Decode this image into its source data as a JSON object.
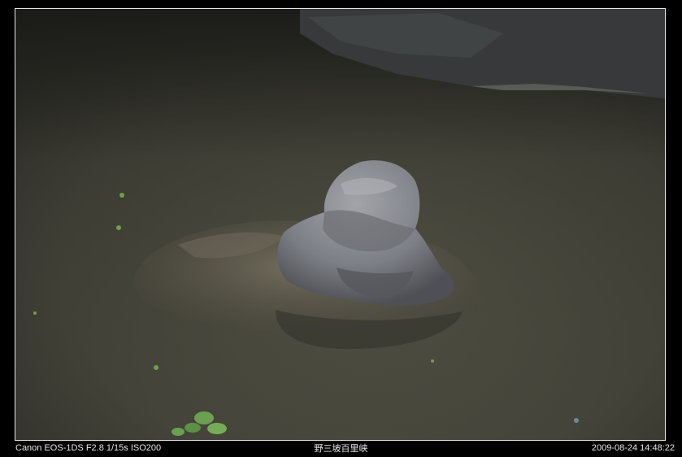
{
  "captions": {
    "camera_info": "Canon EOS-1DS F2.8 1/15s ISO200",
    "location_title": "野三坡百里峡",
    "timestamp": "2009-08-24 14:48:22"
  },
  "scene": {
    "subject": "rock-in-water",
    "colors": {
      "water": "#4a4a3c",
      "water_dark": "#2a2a22",
      "rock_top": "#8c8e94",
      "rock_shadow": "#5a5c60",
      "submerged_rock": "#6a6455",
      "cliff": "#3a3c3e",
      "leaf": "#6fa04a"
    }
  }
}
